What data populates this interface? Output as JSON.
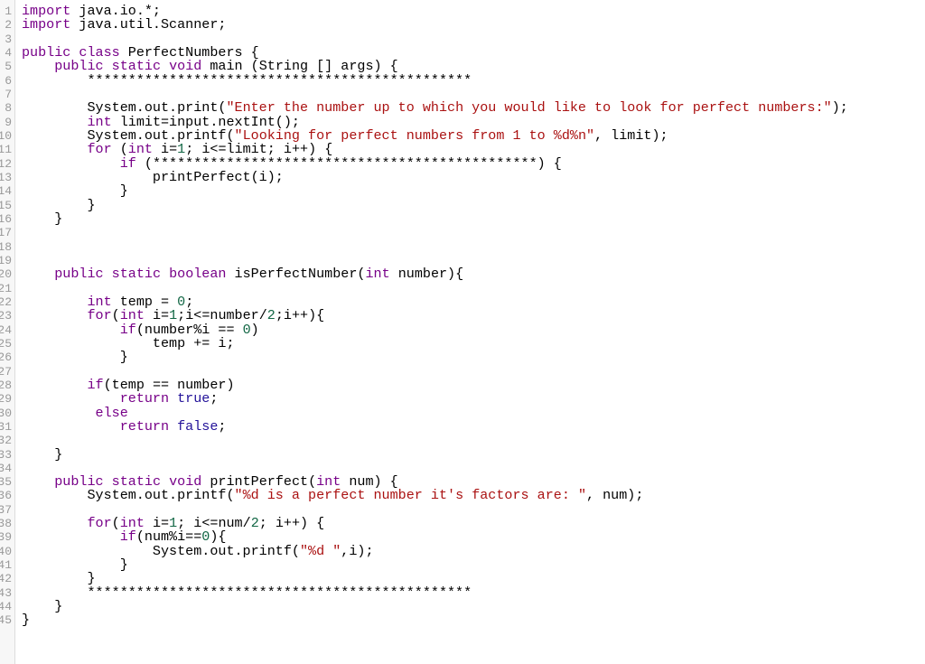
{
  "editor": {
    "language": "java",
    "theme_colors": {
      "keyword": "#770088",
      "string": "#aa1111",
      "number": "#116644",
      "atom": "#221199",
      "line_number": "#999999",
      "gutter_background": "#f7f7f7"
    },
    "lines": [
      [
        [
          "k",
          "import"
        ],
        [
          "p",
          " java.io.*;"
        ]
      ],
      [
        [
          "k",
          "import"
        ],
        [
          "p",
          " java.util.Scanner;"
        ]
      ],
      [],
      [
        [
          "k",
          "public"
        ],
        [
          "p",
          " "
        ],
        [
          "k",
          "class"
        ],
        [
          "p",
          " PerfectNumbers {"
        ]
      ],
      [
        [
          "p",
          "    "
        ],
        [
          "k",
          "public"
        ],
        [
          "p",
          " "
        ],
        [
          "k",
          "static"
        ],
        [
          "p",
          " "
        ],
        [
          "k",
          "void"
        ],
        [
          "p",
          " main (String [] args) {"
        ]
      ],
      [
        [
          "p",
          "        ***********************************************"
        ]
      ],
      [],
      [
        [
          "p",
          "        System.out.print("
        ],
        [
          "s",
          "\"Enter the number up to which you would like to look for perfect numbers:\""
        ],
        [
          "p",
          ");"
        ]
      ],
      [
        [
          "p",
          "        "
        ],
        [
          "k",
          "int"
        ],
        [
          "p",
          " limit=input.nextInt();"
        ]
      ],
      [
        [
          "p",
          "        System.out.printf("
        ],
        [
          "s",
          "\"Looking for perfect numbers from 1 to %d%n\""
        ],
        [
          "p",
          ", limit);"
        ]
      ],
      [
        [
          "p",
          "        "
        ],
        [
          "k",
          "for"
        ],
        [
          "p",
          " ("
        ],
        [
          "k",
          "int"
        ],
        [
          "p",
          " i="
        ],
        [
          "n",
          "1"
        ],
        [
          "p",
          "; i<=limit; i++) {"
        ]
      ],
      [
        [
          "p",
          "            "
        ],
        [
          "k",
          "if"
        ],
        [
          "p",
          " (***********************************************) {"
        ]
      ],
      [
        [
          "p",
          "                printPerfect(i);"
        ]
      ],
      [
        [
          "p",
          "            }"
        ]
      ],
      [
        [
          "p",
          "        }"
        ]
      ],
      [
        [
          "p",
          "    }"
        ]
      ],
      [],
      [],
      [],
      [
        [
          "p",
          "    "
        ],
        [
          "k",
          "public"
        ],
        [
          "p",
          " "
        ],
        [
          "k",
          "static"
        ],
        [
          "p",
          " "
        ],
        [
          "k",
          "boolean"
        ],
        [
          "p",
          " isPerfectNumber("
        ],
        [
          "k",
          "int"
        ],
        [
          "p",
          " number){"
        ]
      ],
      [],
      [
        [
          "p",
          "        "
        ],
        [
          "k",
          "int"
        ],
        [
          "p",
          " temp = "
        ],
        [
          "n",
          "0"
        ],
        [
          "p",
          ";"
        ]
      ],
      [
        [
          "p",
          "        "
        ],
        [
          "k",
          "for"
        ],
        [
          "p",
          "("
        ],
        [
          "k",
          "int"
        ],
        [
          "p",
          " i="
        ],
        [
          "n",
          "1"
        ],
        [
          "p",
          ";i<=number/"
        ],
        [
          "n",
          "2"
        ],
        [
          "p",
          ";i++){"
        ]
      ],
      [
        [
          "p",
          "            "
        ],
        [
          "k",
          "if"
        ],
        [
          "p",
          "(number%i == "
        ],
        [
          "n",
          "0"
        ],
        [
          "p",
          ")"
        ]
      ],
      [
        [
          "p",
          "                temp += i;"
        ]
      ],
      [
        [
          "p",
          "            }"
        ]
      ],
      [],
      [
        [
          "p",
          "        "
        ],
        [
          "k",
          "if"
        ],
        [
          "p",
          "(temp == number)"
        ]
      ],
      [
        [
          "p",
          "            "
        ],
        [
          "k",
          "return"
        ],
        [
          "p",
          " "
        ],
        [
          "a",
          "true"
        ],
        [
          "p",
          ";"
        ]
      ],
      [
        [
          "p",
          "         "
        ],
        [
          "k",
          "else"
        ]
      ],
      [
        [
          "p",
          "            "
        ],
        [
          "k",
          "return"
        ],
        [
          "p",
          " "
        ],
        [
          "a",
          "false"
        ],
        [
          "p",
          ";"
        ]
      ],
      [],
      [
        [
          "p",
          "    }"
        ]
      ],
      [],
      [
        [
          "p",
          "    "
        ],
        [
          "k",
          "public"
        ],
        [
          "p",
          " "
        ],
        [
          "k",
          "static"
        ],
        [
          "p",
          " "
        ],
        [
          "k",
          "void"
        ],
        [
          "p",
          " printPerfect("
        ],
        [
          "k",
          "int"
        ],
        [
          "p",
          " num) {"
        ]
      ],
      [
        [
          "p",
          "        System.out.printf("
        ],
        [
          "s",
          "\"%d is a perfect number it's factors are: \""
        ],
        [
          "p",
          ", num);"
        ]
      ],
      [],
      [
        [
          "p",
          "        "
        ],
        [
          "k",
          "for"
        ],
        [
          "p",
          "("
        ],
        [
          "k",
          "int"
        ],
        [
          "p",
          " i="
        ],
        [
          "n",
          "1"
        ],
        [
          "p",
          "; i<=num/"
        ],
        [
          "n",
          "2"
        ],
        [
          "p",
          "; i++) {"
        ]
      ],
      [
        [
          "p",
          "            "
        ],
        [
          "k",
          "if"
        ],
        [
          "p",
          "(num%i=="
        ],
        [
          "n",
          "0"
        ],
        [
          "p",
          "){"
        ]
      ],
      [
        [
          "p",
          "                System.out.printf("
        ],
        [
          "s",
          "\"%d \""
        ],
        [
          "p",
          ",i);"
        ]
      ],
      [
        [
          "p",
          "            }"
        ]
      ],
      [
        [
          "p",
          "        }"
        ]
      ],
      [
        [
          "p",
          "        ***********************************************"
        ]
      ],
      [
        [
          "p",
          "    }"
        ]
      ],
      [
        [
          "p",
          "}"
        ]
      ]
    ]
  }
}
